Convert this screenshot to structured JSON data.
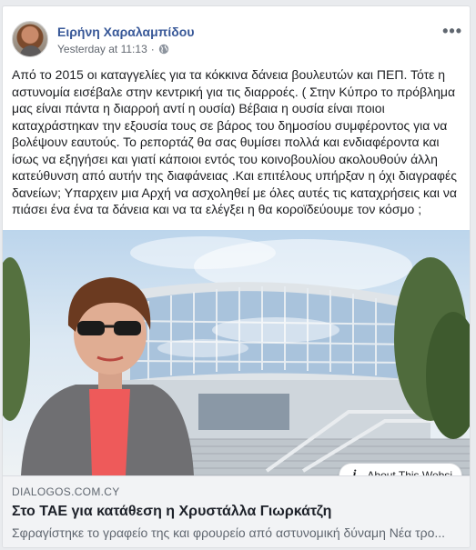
{
  "post": {
    "author": "Ειρήνη Χαραλαμπίδου",
    "timestamp": "Yesterday at 11:13",
    "separator": "·",
    "privacy_icon": "globe-icon",
    "more_icon": "•••",
    "text": "Από το 2015 οι καταγγελίες για τα κόκκινα δάνεια βουλευτών και ΠΕΠ. Τότε η αστυνομία εισέβαλε στην κεντρική για τις διαρροές. ( Στην Κύπρο το πρόβλημα μας είναι πάντα η διαρροή αντί η ουσία) Βέβαια η ουσία είναι ποιοι καταχράστηκαν την εξουσία τους σε βάρος του δημοσίου συμφέροντος για να βολέψουν εαυτούς. Το ρεπορτάζ θα σας θυμίσει πολλά και ενδιαφέροντα και ίσως να εξηγήσει και γιατί κάποιοι εντός του κοινοβουλίου ακολουθούν άλλη κατεύθυνση από αυτήν της διαφάνειας .Και επιτέλους υπήρξαν η όχι διαγραφές δανείων; Υπαρχειν μια Αρχή να ασχοληθεί με όλες αυτές τις καταχρήσεις και να πιάσει ένα ένα τα δάνεια και να τα ελέγξει η θα κοροϊδεύουμε τον κόσμο ;"
  },
  "link_preview": {
    "about_label": "About This Websi",
    "domain": "DIALOGOS.COM.CY",
    "title": "Στο ΤΑΕ για κατάθεση η Χρυστάλλα Γιωρκάτζη",
    "description": "Σφραγίστηκε το γραφείο της και φρουρείο από αστυνομική δύναμη Νέα τρο..."
  },
  "colors": {
    "author_link": "#385898",
    "meta_text": "#616770",
    "caption_bg": "#f2f3f5"
  }
}
